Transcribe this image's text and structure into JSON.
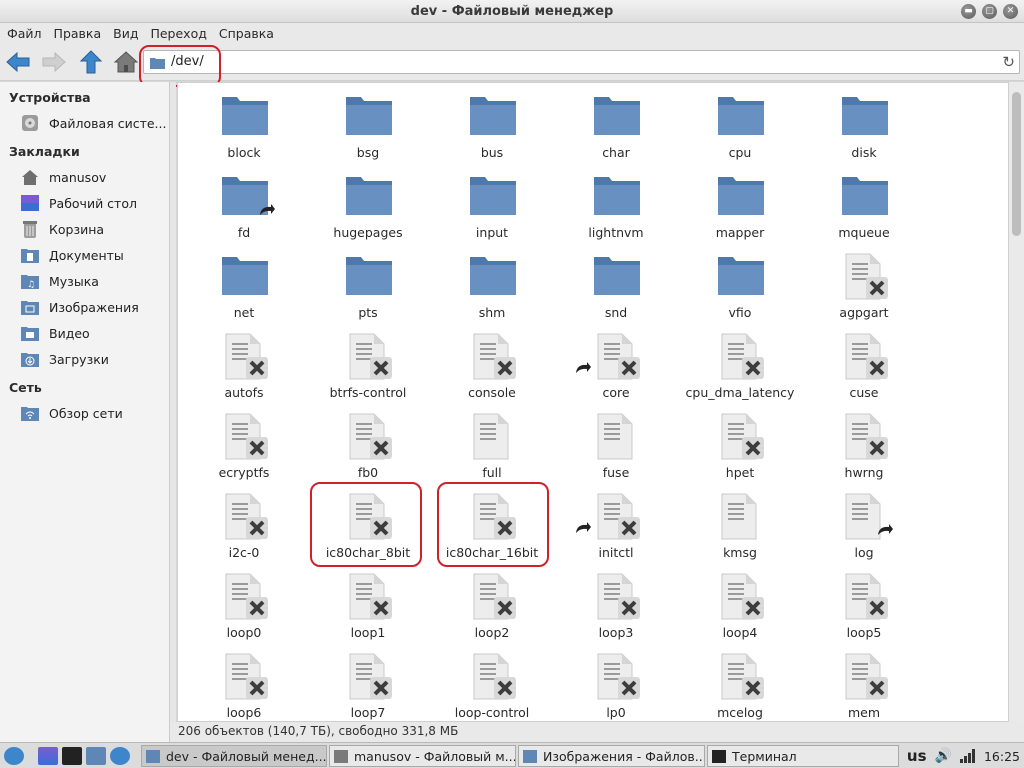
{
  "window": {
    "title": "dev - Файловый менеджер"
  },
  "menu": [
    "Файл",
    "Правка",
    "Вид",
    "Переход",
    "Справка"
  ],
  "address": {
    "path": "/dev/"
  },
  "sidebar": {
    "sections": [
      {
        "title": "Устройства",
        "items": [
          {
            "label": "Файловая систе...",
            "icon": "drive-icon"
          }
        ]
      },
      {
        "title": "Закладки",
        "items": [
          {
            "label": "manusov",
            "icon": "home-icon"
          },
          {
            "label": "Рабочий стол",
            "icon": "desktop-icon"
          },
          {
            "label": "Корзина",
            "icon": "trash-icon"
          },
          {
            "label": "Документы",
            "icon": "documents-icon"
          },
          {
            "label": "Музыка",
            "icon": "music-icon"
          },
          {
            "label": "Изображения",
            "icon": "pictures-icon"
          },
          {
            "label": "Видео",
            "icon": "video-icon"
          },
          {
            "label": "Загрузки",
            "icon": "downloads-icon"
          }
        ]
      },
      {
        "title": "Сеть",
        "items": [
          {
            "label": "Обзор сети",
            "icon": "network-icon"
          }
        ]
      }
    ]
  },
  "files": [
    {
      "name": "block",
      "type": "folder"
    },
    {
      "name": "bsg",
      "type": "folder"
    },
    {
      "name": "bus",
      "type": "folder"
    },
    {
      "name": "char",
      "type": "folder"
    },
    {
      "name": "cpu",
      "type": "folder"
    },
    {
      "name": "disk",
      "type": "folder"
    },
    {
      "name": "fd",
      "type": "folder-link"
    },
    {
      "name": "hugepages",
      "type": "folder"
    },
    {
      "name": "input",
      "type": "folder"
    },
    {
      "name": "lightnvm",
      "type": "folder"
    },
    {
      "name": "mapper",
      "type": "folder"
    },
    {
      "name": "mqueue",
      "type": "folder"
    },
    {
      "name": "net",
      "type": "folder"
    },
    {
      "name": "pts",
      "type": "folder"
    },
    {
      "name": "shm",
      "type": "folder"
    },
    {
      "name": "snd",
      "type": "folder"
    },
    {
      "name": "vfio",
      "type": "folder"
    },
    {
      "name": "agpgart",
      "type": "locked"
    },
    {
      "name": "autofs",
      "type": "locked"
    },
    {
      "name": "btrfs-control",
      "type": "locked"
    },
    {
      "name": "console",
      "type": "locked"
    },
    {
      "name": "core",
      "type": "locked-link"
    },
    {
      "name": "cpu_dma_latency",
      "type": "locked"
    },
    {
      "name": "cuse",
      "type": "locked"
    },
    {
      "name": "ecryptfs",
      "type": "locked"
    },
    {
      "name": "fb0",
      "type": "locked"
    },
    {
      "name": "full",
      "type": "file"
    },
    {
      "name": "fuse",
      "type": "file"
    },
    {
      "name": "hpet",
      "type": "locked"
    },
    {
      "name": "hwrng",
      "type": "locked"
    },
    {
      "name": "i2c-0",
      "type": "locked"
    },
    {
      "name": "ic80char_8bit",
      "type": "locked"
    },
    {
      "name": "ic80char_16bit",
      "type": "locked"
    },
    {
      "name": "initctl",
      "type": "locked-link"
    },
    {
      "name": "kmsg",
      "type": "file"
    },
    {
      "name": "log",
      "type": "file-link"
    },
    {
      "name": "loop0",
      "type": "locked"
    },
    {
      "name": "loop1",
      "type": "locked"
    },
    {
      "name": "loop2",
      "type": "locked"
    },
    {
      "name": "loop3",
      "type": "locked"
    },
    {
      "name": "loop4",
      "type": "locked"
    },
    {
      "name": "loop5",
      "type": "locked"
    },
    {
      "name": "loop6",
      "type": "locked"
    },
    {
      "name": "loop7",
      "type": "locked"
    },
    {
      "name": "loop-control",
      "type": "locked"
    },
    {
      "name": "lp0",
      "type": "locked"
    },
    {
      "name": "mcelog",
      "type": "locked"
    },
    {
      "name": "mem",
      "type": "locked"
    }
  ],
  "status": {
    "text": "206 объектов (140,7 ТБ), свободно 331,8 МБ"
  },
  "taskbar": {
    "tasks": [
      {
        "label": "dev - Файловый менед...",
        "active": true
      },
      {
        "label": "manusov - Файловый м...",
        "active": false
      },
      {
        "label": "Изображения - Файлов...",
        "active": false
      },
      {
        "label": "Терминал",
        "active": false
      }
    ],
    "keyboard_layout": "us",
    "clock": "16:25"
  },
  "colors": {
    "folder": "#5e87b5",
    "highlight": "#d0202a",
    "x_badge": "#4a4a4a"
  }
}
